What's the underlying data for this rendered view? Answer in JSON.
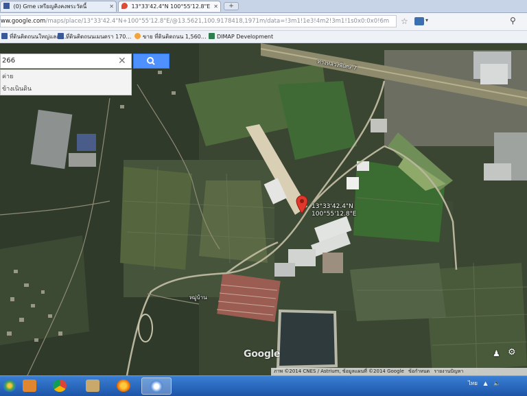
{
  "browser": {
    "tabs": [
      {
        "label": "(0) Gme เหรียญคิงคงพระวัดนี้",
        "icon": "facebook-icon",
        "active": false
      },
      {
        "label": "13°33'42.4\"N 100°55'12.8\"E",
        "icon": "maps-icon",
        "active": true
      }
    ],
    "new_tab_glyph": "+",
    "url_host": "ww.google.com",
    "url_rest": "/maps/place/13°33'42.4\"N+100°55'12.8\"E/@13.5621,100.9178418,1971m/data=!3m1!1e3!4m2!3m1!1s0x0:0x0!6m",
    "bookmarks": [
      {
        "label": "ที่ดินติดถนนใหญ่และพ…",
        "icon": "facebook-icon"
      },
      {
        "label": "ที่ดินติดถนนเมนดรา 170…",
        "icon": "facebook-icon"
      },
      {
        "label": "ขาย ที่ดินติดถนน 1,560…",
        "icon": "site-icon"
      },
      {
        "label": "DIMAP Development",
        "icon": "dimap-icon"
      }
    ]
  },
  "map": {
    "search_value": "266",
    "suggestions": [
      "ค่าย",
      "ข้างเนินดิน"
    ],
    "coordinate_label": [
      "13°33'42.4\"N",
      "100°55'12.8\"E"
    ],
    "road_label": "ทางหลวงพิเศษ 7",
    "village_label": "หมู่บ้าน",
    "logo": "Google",
    "copyright": [
      "ภาพ ©2014 CNES / Astrium, ข้อมูลแผนที่ ©2014 Google",
      "ข้อกำหนด",
      "รายงานปัญหา"
    ],
    "pin_color": "#e0392b"
  },
  "taskbar": {
    "apps": [
      "start-button",
      "file-explorer",
      "chrome",
      "app-icon",
      "firefox",
      "app-window"
    ],
    "tray": [
      "ไทย",
      "▲",
      "🔈"
    ]
  }
}
